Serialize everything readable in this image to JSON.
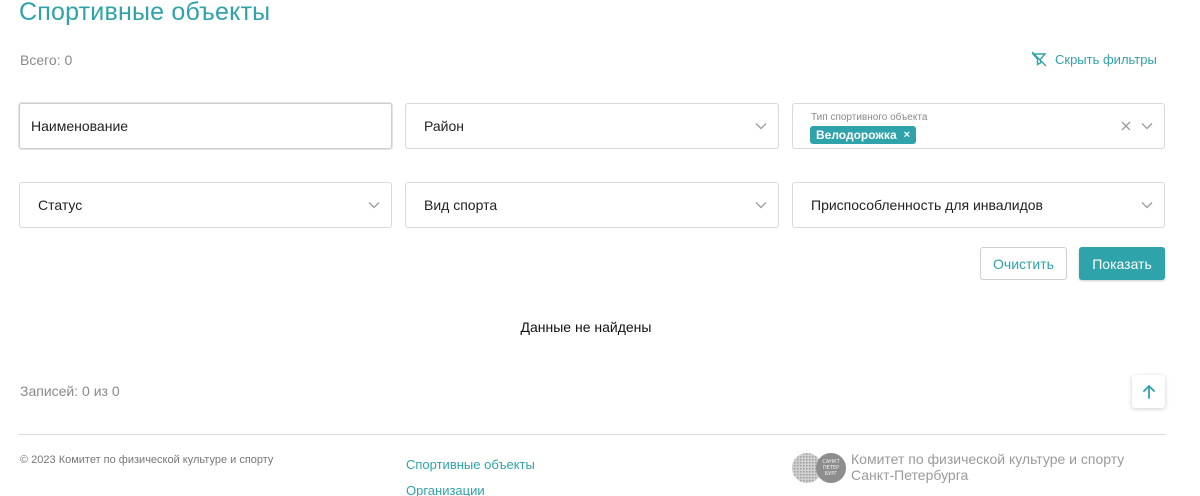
{
  "page": {
    "title": "Спортивные объекты",
    "total": "Всего: 0",
    "hide_filters": "Скрыть фильтры"
  },
  "filters": {
    "name_placeholder": "Наименование",
    "district_label": "Район",
    "type_label": "Тип спортивного объекта",
    "type_selected": [
      "Велодорожка"
    ],
    "chip_remove": "×",
    "status_label": "Статус",
    "sport_label": "Вид спорта",
    "access_label": "Приспособленность для инвалидов"
  },
  "actions": {
    "clear": "Очистить",
    "show": "Показать"
  },
  "results": {
    "empty": "Данные не найдены",
    "records": "Записей: 0 из 0"
  },
  "footer": {
    "copyright": "© 2023 Комитет по физической культуре и спорту",
    "links": [
      "Спортивные объекты",
      "Организации"
    ],
    "org_line1": "Комитет по физической культуре и спорту",
    "org_line2": "Санкт-Петербурга",
    "logo_text": [
      "САНКТ",
      "ПЕТЕР",
      "БУРГ"
    ]
  },
  "colors": {
    "accent": "#2ea3aa",
    "muted": "#8a8a8a",
    "border": "#d9d9d9"
  },
  "icons": {
    "hide_filters": "filter-off-icon",
    "select": "chevron-down-icon",
    "clear": "close-icon",
    "scroll_top": "arrow-up-icon"
  }
}
